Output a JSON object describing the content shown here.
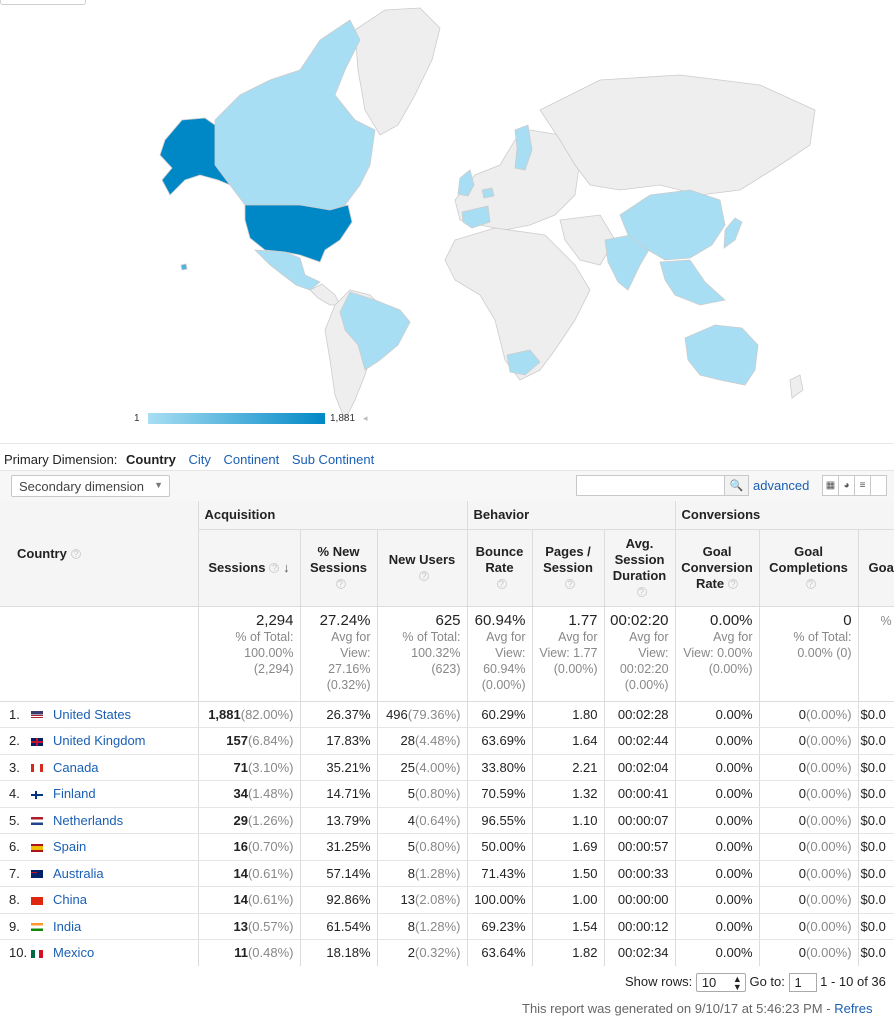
{
  "legend": {
    "min": "1",
    "max": "1,881"
  },
  "colors": {
    "land": "#eeeeee",
    "land_border": "#cccccc",
    "low": "#a8def3",
    "mid": "#4db3e0",
    "high": "#0088c6",
    "link": "#1a5fb4"
  },
  "primary_dimension": {
    "label": "Primary Dimension:",
    "current": "Country",
    "options": [
      "City",
      "Continent",
      "Sub Continent"
    ]
  },
  "secondary_dimension": {
    "label": "Secondary dimension"
  },
  "search": {
    "button_icon": "magnifier-icon",
    "advanced": "advanced"
  },
  "view_icons": [
    "table-icon",
    "pie-icon",
    "bar-icon",
    "extra-icon"
  ],
  "table": {
    "groups": {
      "acquisition": "Acquisition",
      "behavior": "Behavior",
      "conversions": "Conversions"
    },
    "country_header": "Country",
    "columns": [
      "Sessions",
      "% New Sessions",
      "New Users",
      "Bounce Rate",
      "Pages / Session",
      "Avg. Session Duration",
      "Goal Conversion Rate",
      "Goal Completions",
      "Goa"
    ],
    "totals": [
      {
        "value": "2,294",
        "sub": "% of Total: 100.00% (2,294)"
      },
      {
        "value": "27.24%",
        "sub": "Avg for View: 27.16% (0.32%)"
      },
      {
        "value": "625",
        "sub": "% of Total: 100.32% (623)"
      },
      {
        "value": "60.94%",
        "sub": "Avg for View: 60.94% (0.00%)"
      },
      {
        "value": "1.77",
        "sub": "Avg for View: 1.77 (0.00%)"
      },
      {
        "value": "00:02:20",
        "sub": "Avg for View: 00:02:20 (0.00%)"
      },
      {
        "value": "0.00%",
        "sub": "Avg for View: 0.00% (0.00%)"
      },
      {
        "value": "0",
        "sub": "% of Total: 0.00% (0)"
      },
      {
        "value": "",
        "sub": "%"
      }
    ],
    "rows": [
      {
        "idx": "1.",
        "flag": "us",
        "country": "United States",
        "sessions": "1,881",
        "sessions_pct": "(82.00%)",
        "new_sessions": "26.37%",
        "new_users": "496",
        "new_users_pct": "(79.36%)",
        "bounce": "60.29%",
        "pages": "1.80",
        "duration": "00:02:28",
        "conv_rate": "0.00%",
        "completions": "0",
        "completions_pct": "(0.00%)",
        "value": "$0.0"
      },
      {
        "idx": "2.",
        "flag": "gb",
        "country": "United Kingdom",
        "sessions": "157",
        "sessions_pct": "(6.84%)",
        "new_sessions": "17.83%",
        "new_users": "28",
        "new_users_pct": "(4.48%)",
        "bounce": "63.69%",
        "pages": "1.64",
        "duration": "00:02:44",
        "conv_rate": "0.00%",
        "completions": "0",
        "completions_pct": "(0.00%)",
        "value": "$0.0"
      },
      {
        "idx": "3.",
        "flag": "ca",
        "country": "Canada",
        "sessions": "71",
        "sessions_pct": "(3.10%)",
        "new_sessions": "35.21%",
        "new_users": "25",
        "new_users_pct": "(4.00%)",
        "bounce": "33.80%",
        "pages": "2.21",
        "duration": "00:02:04",
        "conv_rate": "0.00%",
        "completions": "0",
        "completions_pct": "(0.00%)",
        "value": "$0.0"
      },
      {
        "idx": "4.",
        "flag": "fi",
        "country": "Finland",
        "sessions": "34",
        "sessions_pct": "(1.48%)",
        "new_sessions": "14.71%",
        "new_users": "5",
        "new_users_pct": "(0.80%)",
        "bounce": "70.59%",
        "pages": "1.32",
        "duration": "00:00:41",
        "conv_rate": "0.00%",
        "completions": "0",
        "completions_pct": "(0.00%)",
        "value": "$0.0"
      },
      {
        "idx": "5.",
        "flag": "nl",
        "country": "Netherlands",
        "sessions": "29",
        "sessions_pct": "(1.26%)",
        "new_sessions": "13.79%",
        "new_users": "4",
        "new_users_pct": "(0.64%)",
        "bounce": "96.55%",
        "pages": "1.10",
        "duration": "00:00:07",
        "conv_rate": "0.00%",
        "completions": "0",
        "completions_pct": "(0.00%)",
        "value": "$0.0"
      },
      {
        "idx": "6.",
        "flag": "es",
        "country": "Spain",
        "sessions": "16",
        "sessions_pct": "(0.70%)",
        "new_sessions": "31.25%",
        "new_users": "5",
        "new_users_pct": "(0.80%)",
        "bounce": "50.00%",
        "pages": "1.69",
        "duration": "00:00:57",
        "conv_rate": "0.00%",
        "completions": "0",
        "completions_pct": "(0.00%)",
        "value": "$0.0"
      },
      {
        "idx": "7.",
        "flag": "au",
        "country": "Australia",
        "sessions": "14",
        "sessions_pct": "(0.61%)",
        "new_sessions": "57.14%",
        "new_users": "8",
        "new_users_pct": "(1.28%)",
        "bounce": "71.43%",
        "pages": "1.50",
        "duration": "00:00:33",
        "conv_rate": "0.00%",
        "completions": "0",
        "completions_pct": "(0.00%)",
        "value": "$0.0"
      },
      {
        "idx": "8.",
        "flag": "cn",
        "country": "China",
        "sessions": "14",
        "sessions_pct": "(0.61%)",
        "new_sessions": "92.86%",
        "new_users": "13",
        "new_users_pct": "(2.08%)",
        "bounce": "100.00%",
        "pages": "1.00",
        "duration": "00:00:00",
        "conv_rate": "0.00%",
        "completions": "0",
        "completions_pct": "(0.00%)",
        "value": "$0.0"
      },
      {
        "idx": "9.",
        "flag": "in",
        "country": "India",
        "sessions": "13",
        "sessions_pct": "(0.57%)",
        "new_sessions": "61.54%",
        "new_users": "8",
        "new_users_pct": "(1.28%)",
        "bounce": "69.23%",
        "pages": "1.54",
        "duration": "00:00:12",
        "conv_rate": "0.00%",
        "completions": "0",
        "completions_pct": "(0.00%)",
        "value": "$0.0"
      },
      {
        "idx": "10.",
        "flag": "mx",
        "country": "Mexico",
        "sessions": "11",
        "sessions_pct": "(0.48%)",
        "new_sessions": "18.18%",
        "new_users": "2",
        "new_users_pct": "(0.32%)",
        "bounce": "63.64%",
        "pages": "1.82",
        "duration": "00:02:34",
        "conv_rate": "0.00%",
        "completions": "0",
        "completions_pct": "(0.00%)",
        "value": "$0.0"
      }
    ]
  },
  "pagination": {
    "show_rows_label": "Show rows:",
    "rows_value": "10",
    "goto_label": "Go to:",
    "goto_value": "1",
    "range": "1 - 10 of 36"
  },
  "footer": {
    "generated": "This report was generated on 9/10/17 at 5:46:23 PM -",
    "refresh": "Refres"
  }
}
